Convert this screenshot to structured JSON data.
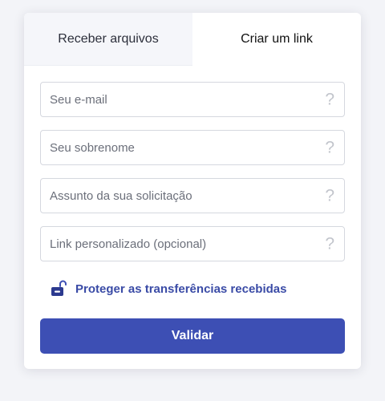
{
  "tabs": [
    {
      "label": "Receber arquivos",
      "active": false
    },
    {
      "label": "Criar um link",
      "active": true
    }
  ],
  "fields": [
    {
      "placeholder": "Seu e-mail",
      "value": "",
      "help_icon": "question-mark-icon"
    },
    {
      "placeholder": "Seu sobrenome",
      "value": "",
      "help_icon": "question-mark-icon"
    },
    {
      "placeholder": "Assunto da sua solicitação",
      "value": "",
      "help_icon": "question-mark-icon"
    },
    {
      "placeholder": "Link personalizado (opcional)",
      "value": "",
      "help_icon": "question-mark-icon"
    }
  ],
  "help_glyph": "?",
  "protect": {
    "label": "Proteger as transferências recebidas",
    "icon": "unlocked-padlock-icon"
  },
  "submit_label": "Validar",
  "colors": {
    "accent": "#3d4fb4",
    "link": "#3a4ba6",
    "background": "#f3f4f8"
  }
}
